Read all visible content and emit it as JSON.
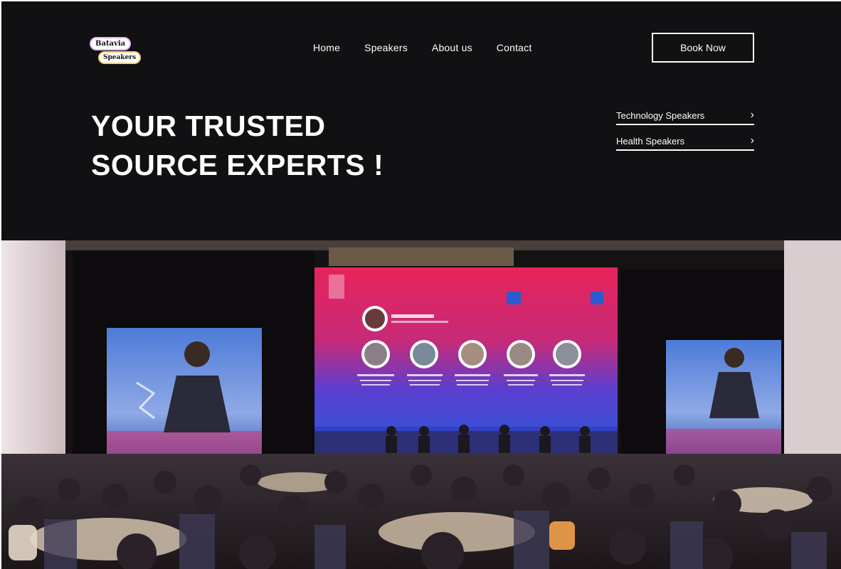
{
  "brand": {
    "line1": "Batavia",
    "line2": "Speakers"
  },
  "nav": {
    "items": [
      "Home",
      "Speakers",
      "About us",
      "Contact"
    ]
  },
  "cta": {
    "label": "Book Now"
  },
  "hero": {
    "headline_line1": "YOUR TRUSTED",
    "headline_line2": "SOURCE EXPERTS !"
  },
  "categories": [
    {
      "label": "Technology Speakers"
    },
    {
      "label": "Health Speakers"
    }
  ],
  "colors": {
    "background": "#111012",
    "text": "#ffffff",
    "screen_pink": "#e0245e",
    "screen_blue": "#3a4fd6"
  },
  "icons": {
    "chevron": "chevron-right-icon"
  }
}
